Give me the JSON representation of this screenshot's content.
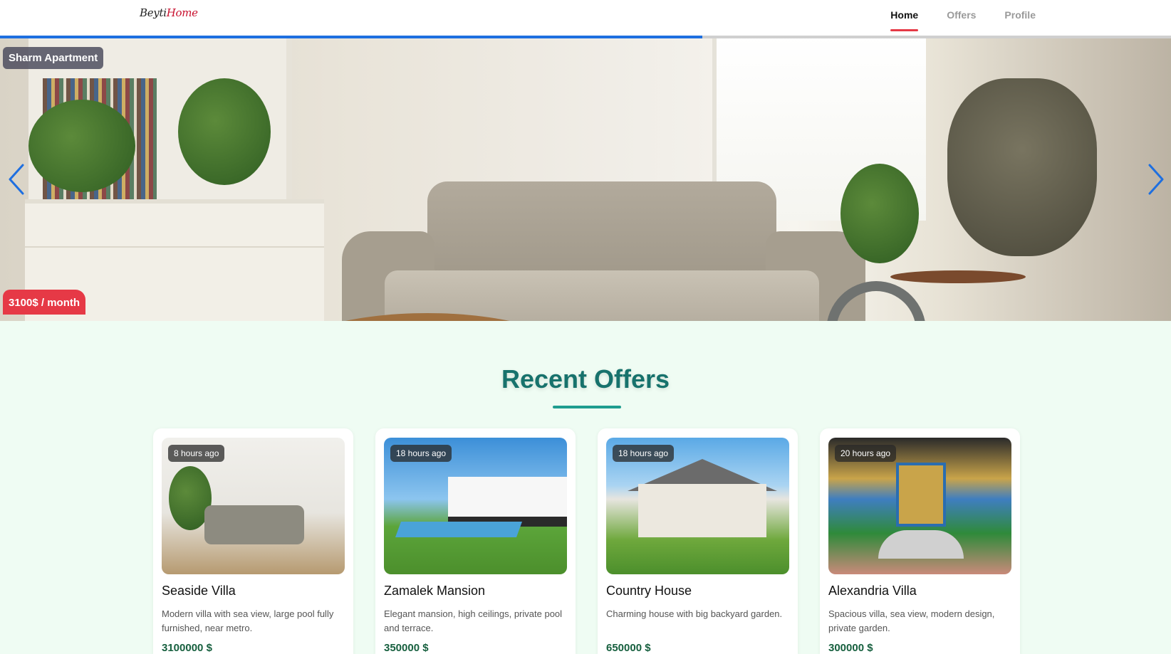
{
  "nav": {
    "brand_part1": "Beyti",
    "brand_part2": "Home",
    "links": [
      {
        "label": "Home",
        "active": true
      },
      {
        "label": "Offers",
        "active": false
      },
      {
        "label": "Profile",
        "active": false
      }
    ]
  },
  "hero": {
    "title": "Sharm Apartment",
    "price": "3100$ / month",
    "prev_icon": "chevron-left-icon",
    "next_icon": "chevron-right-icon",
    "slide_progress": 0.6,
    "progress_color": "#1e6fe0"
  },
  "section": {
    "title": "Recent Offers"
  },
  "offers": [
    {
      "badge": "8 hours ago",
      "title": "Seaside Villa",
      "description": "Modern villa with sea view, large pool fully furnished, near metro.",
      "price": "3100000 $"
    },
    {
      "badge": "18 hours ago",
      "title": "Zamalek Mansion",
      "description": "Elegant mansion, high ceilings, private pool and terrace.",
      "price": "350000 $"
    },
    {
      "badge": "18 hours ago",
      "title": "Country House",
      "description": "Charming house with big backyard garden.",
      "price": "650000 $"
    },
    {
      "badge": "20 hours ago",
      "title": "Alexandria Villa",
      "description": "Spacious villa, sea view, modern design, private garden.",
      "price": "300000 $"
    }
  ],
  "colors": {
    "accent": "#e63946",
    "heading": "#17726c",
    "price": "#17603f",
    "page_bg": "#effcf3"
  }
}
